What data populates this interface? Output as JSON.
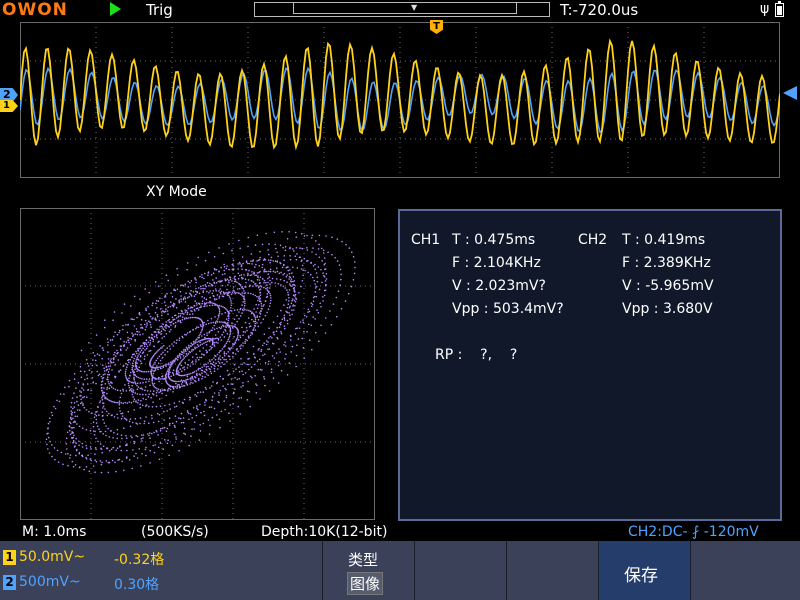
{
  "topbar": {
    "logo": "OWON",
    "status": "Trig",
    "trigger_time": "T:-720.0us"
  },
  "markers": {
    "trigger": "T",
    "ch2": "2",
    "ch1": "1"
  },
  "xy_label": "XY Mode",
  "measurements": {
    "ch1": {
      "label": "CH1",
      "T": "T : 0.475ms",
      "F": "F : 2.104KHz",
      "V": "V : 2.023mV?",
      "Vpp": "Vpp : 503.4mV?"
    },
    "ch2": {
      "label": "CH2",
      "T": "T : 0.419ms",
      "F": "F : 2.389KHz",
      "V": "V : -5.965mV",
      "Vpp": "Vpp : 3.680V"
    },
    "rp": "RP :    ?,    ?"
  },
  "status_line": {
    "timebase": "M: 1.0ms",
    "sample_rate": "(500KS/s)",
    "depth": "Depth:10K(12-bit)",
    "trigger": "CH2:DC- ⨏ -120mV"
  },
  "softbar": {
    "ch1": {
      "num": "1",
      "scale": "50.0mV~",
      "offset": "-0.32格"
    },
    "ch2": {
      "num": "2",
      "scale": "500mV~",
      "offset": "0.30格"
    },
    "type_label": "类型",
    "type_value": "图像",
    "save_label": "保存"
  },
  "colors": {
    "ch1": "#ffd21a",
    "ch2": "#4fa3ff",
    "xy_trace": "#b58cff",
    "brand": "#ff7a10"
  }
}
